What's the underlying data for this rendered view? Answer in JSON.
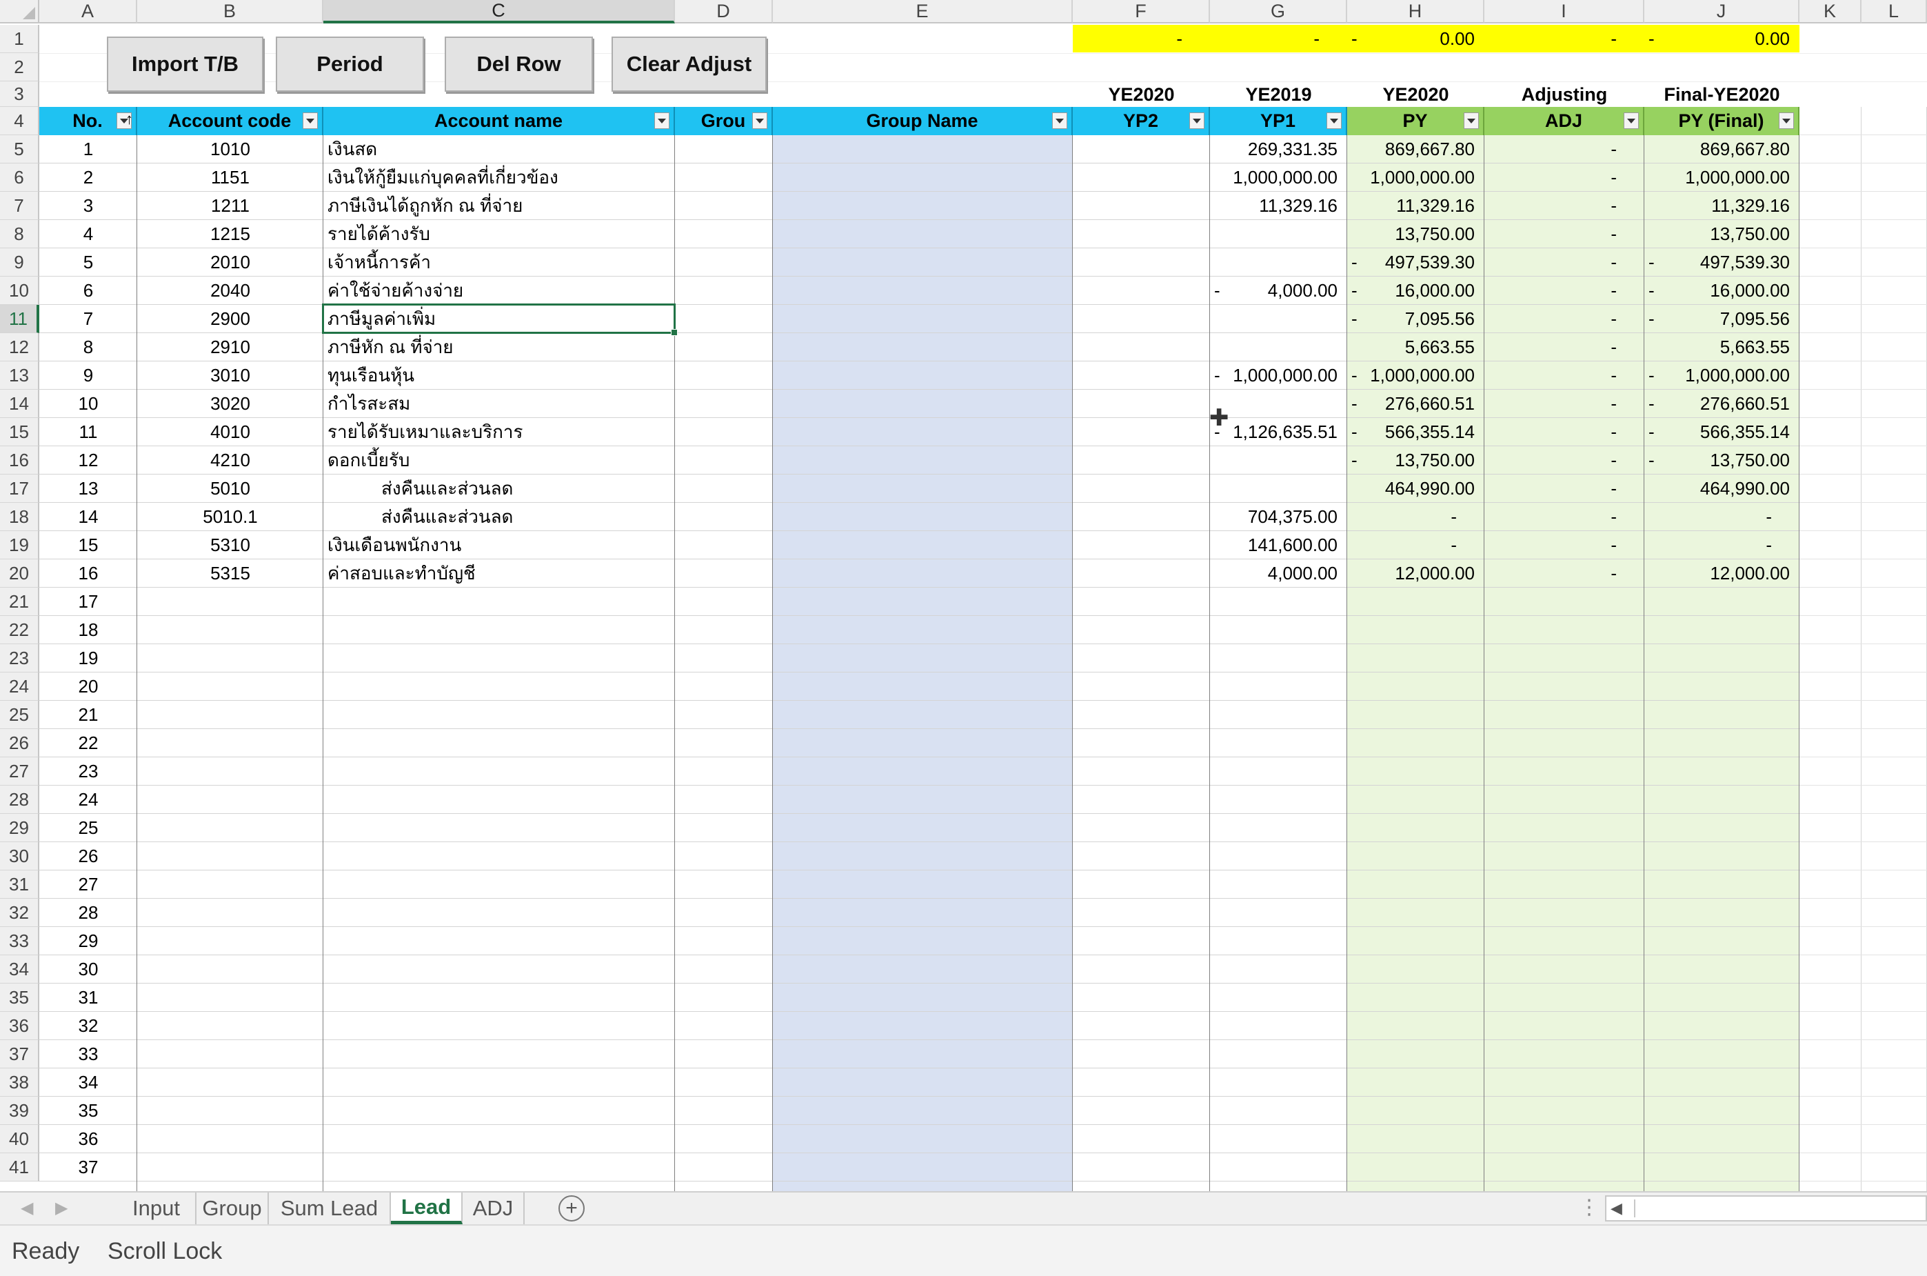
{
  "columns": [
    "A",
    "B",
    "C",
    "D",
    "E",
    "F",
    "G",
    "H",
    "I",
    "J",
    "K",
    "L"
  ],
  "active_column": "C",
  "active_row": 11,
  "buttons": {
    "import": "Import T/B",
    "period": "Period",
    "del_row": "Del Row",
    "clear_adjust": "Clear Adjust"
  },
  "row1_values": {
    "F": "-",
    "G": "-",
    "H_neg": "-",
    "H": "0.00",
    "I": "-",
    "J_neg": "-",
    "J": "0.00"
  },
  "year_labels": {
    "F": "YE2020",
    "G": "YE2019",
    "H": "YE2020",
    "I": "Adjusting",
    "J": "Final-YE2020"
  },
  "headers": {
    "no": "No.",
    "account_code": "Account code",
    "account_name": "Account name",
    "group": "Grou",
    "group_name": "Group Name",
    "yp2": "YP2",
    "yp1": "YP1",
    "py": "PY",
    "adj": "ADJ",
    "py_final": "PY (Final)"
  },
  "rows": [
    {
      "no": "1",
      "code": "1010",
      "name": "เงินสด",
      "yp1": "269,331.35",
      "yp1_neg": false,
      "py": "869,667.80",
      "py_neg": false,
      "adj": "-",
      "fin": "869,667.80",
      "fin_neg": false
    },
    {
      "no": "2",
      "code": "1151",
      "name": "เงินให้กู้ยืมแก่บุคคลที่เกี่ยวข้อง",
      "yp1": "1,000,000.00",
      "yp1_neg": false,
      "py": "1,000,000.00",
      "py_neg": false,
      "adj": "-",
      "fin": "1,000,000.00",
      "fin_neg": false
    },
    {
      "no": "3",
      "code": "1211",
      "name": "ภาษีเงินได้ถูกหัก ณ ที่จ่าย",
      "yp1": "11,329.16",
      "yp1_neg": false,
      "py": "11,329.16",
      "py_neg": false,
      "adj": "-",
      "fin": "11,329.16",
      "fin_neg": false
    },
    {
      "no": "4",
      "code": "1215",
      "name": "รายได้ค้างรับ",
      "yp1": "",
      "yp1_neg": false,
      "py": "13,750.00",
      "py_neg": false,
      "adj": "-",
      "fin": "13,750.00",
      "fin_neg": false
    },
    {
      "no": "5",
      "code": "2010",
      "name": "เจ้าหนี้การค้า",
      "yp1": "",
      "yp1_neg": false,
      "py": "497,539.30",
      "py_neg": true,
      "adj": "-",
      "fin": "497,539.30",
      "fin_neg": true
    },
    {
      "no": "6",
      "code": "2040",
      "name": "ค่าใช้จ่ายค้างจ่าย",
      "yp1": "4,000.00",
      "yp1_neg": true,
      "py": "16,000.00",
      "py_neg": true,
      "adj": "-",
      "fin": "16,000.00",
      "fin_neg": true
    },
    {
      "no": "7",
      "code": "2900",
      "name": "ภาษีมูลค่าเพิ่ม",
      "yp1": "",
      "yp1_neg": false,
      "py": "7,095.56",
      "py_neg": true,
      "adj": "-",
      "fin": "7,095.56",
      "fin_neg": true
    },
    {
      "no": "8",
      "code": "2910",
      "name": "ภาษีหัก ณ ที่จ่าย",
      "yp1": "",
      "yp1_neg": false,
      "py": "5,663.55",
      "py_neg": false,
      "adj": "-",
      "fin": "5,663.55",
      "fin_neg": false
    },
    {
      "no": "9",
      "code": "3010",
      "name": "ทุนเรือนหุ้น",
      "yp1": "1,000,000.00",
      "yp1_neg": true,
      "py": "1,000,000.00",
      "py_neg": true,
      "adj": "-",
      "fin": "1,000,000.00",
      "fin_neg": true
    },
    {
      "no": "10",
      "code": "3020",
      "name": "กำไรสะสม",
      "yp1": "",
      "yp1_neg": false,
      "py": "276,660.51",
      "py_neg": true,
      "adj": "-",
      "fin": "276,660.51",
      "fin_neg": true
    },
    {
      "no": "11",
      "code": "4010",
      "name": "รายได้รับเหมาและบริการ",
      "yp1": "1,126,635.51",
      "yp1_neg": true,
      "py": "566,355.14",
      "py_neg": true,
      "adj": "-",
      "fin": "566,355.14",
      "fin_neg": true
    },
    {
      "no": "12",
      "code": "4210",
      "name": "ดอกเบี้ยรับ",
      "yp1": "",
      "yp1_neg": false,
      "py": "13,750.00",
      "py_neg": true,
      "adj": "-",
      "fin": "13,750.00",
      "fin_neg": true
    },
    {
      "no": "13",
      "code": "5010",
      "name": "ส่งคืนและส่วนลด",
      "indent": true,
      "yp1": "",
      "yp1_neg": false,
      "py": "464,990.00",
      "py_neg": false,
      "adj": "-",
      "fin": "464,990.00",
      "fin_neg": false
    },
    {
      "no": "14",
      "code": "5010.1",
      "name": "ส่งคืนและส่วนลด",
      "indent": true,
      "yp1": "704,375.00",
      "yp1_neg": false,
      "py": "-",
      "py_neg": false,
      "adj": "-",
      "fin": "-",
      "fin_neg": false
    },
    {
      "no": "15",
      "code": "5310",
      "name": "เงินเดือนพนักงาน",
      "yp1": "141,600.00",
      "yp1_neg": false,
      "py": "-",
      "py_neg": false,
      "adj": "-",
      "fin": "-",
      "fin_neg": false
    },
    {
      "no": "16",
      "code": "5315",
      "name": "ค่าสอบและทำบัญชี",
      "yp1": "4,000.00",
      "yp1_neg": false,
      "py": "12,000.00",
      "py_neg": false,
      "adj": "-",
      "fin": "12,000.00",
      "fin_neg": false
    },
    {
      "no": "17"
    },
    {
      "no": "18"
    },
    {
      "no": "19"
    },
    {
      "no": "20"
    },
    {
      "no": "21"
    },
    {
      "no": "22"
    },
    {
      "no": "23"
    },
    {
      "no": "24"
    },
    {
      "no": "25"
    },
    {
      "no": "26"
    },
    {
      "no": "27"
    },
    {
      "no": "28"
    },
    {
      "no": "29"
    },
    {
      "no": "30"
    },
    {
      "no": "31"
    },
    {
      "no": "32"
    },
    {
      "no": "33"
    },
    {
      "no": "34"
    },
    {
      "no": "35"
    },
    {
      "no": "36"
    },
    {
      "no": "37"
    }
  ],
  "sheet_tabs": [
    "Input",
    "Group",
    "Sum Lead",
    "Lead",
    "ADJ"
  ],
  "active_tab": "Lead",
  "status": {
    "ready": "Ready",
    "scroll_lock": "Scroll Lock"
  },
  "colors": {
    "header_blue": "#1fc2f2",
    "header_green": "#97d260",
    "green_fill": "#ebf6dd",
    "group_fill": "#d9e1f2",
    "highlight": "#ffff00",
    "excel_green": "#217346"
  }
}
